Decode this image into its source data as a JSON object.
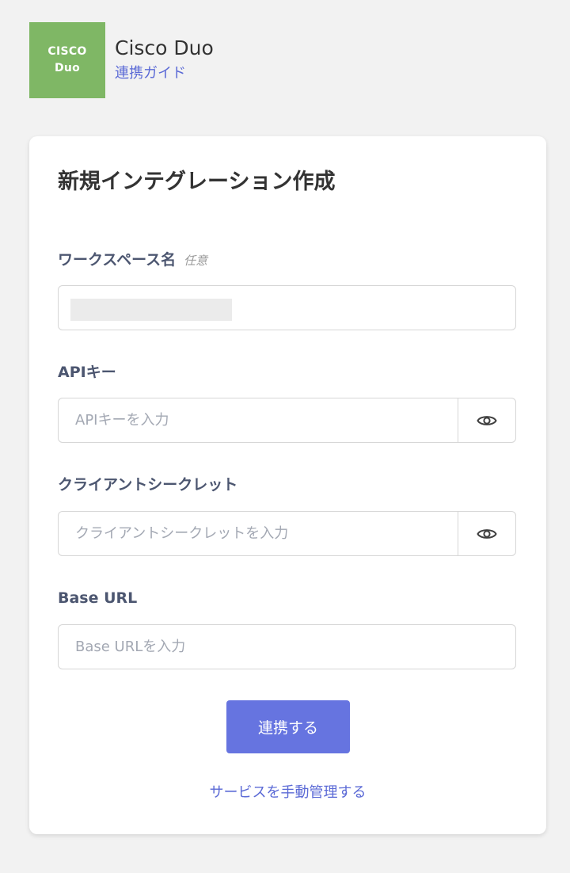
{
  "header": {
    "logo_line1": "CISCO",
    "logo_line2": "Duo",
    "app_title": "Cisco Duo",
    "guide_link": "連携ガイド"
  },
  "form": {
    "title": "新規インテグレーション作成",
    "workspace": {
      "label": "ワークスペース名",
      "optional": "任意"
    },
    "api_key": {
      "label": "APIキー",
      "placeholder": "APIキーを入力"
    },
    "client_secret": {
      "label": "クライアントシークレット",
      "placeholder": "クライアントシークレットを入力"
    },
    "base_url": {
      "label": "Base URL",
      "placeholder": "Base URLを入力"
    },
    "submit_label": "連携する",
    "manual_link": "サービスを手動管理する"
  },
  "colors": {
    "background": "#f2f2f2",
    "logo_green": "#7fb765",
    "accent": "#6674e0",
    "link": "#5b6ad6"
  },
  "icons": {
    "api_key_toggle": "eye-icon",
    "client_secret_toggle": "eye-icon"
  }
}
